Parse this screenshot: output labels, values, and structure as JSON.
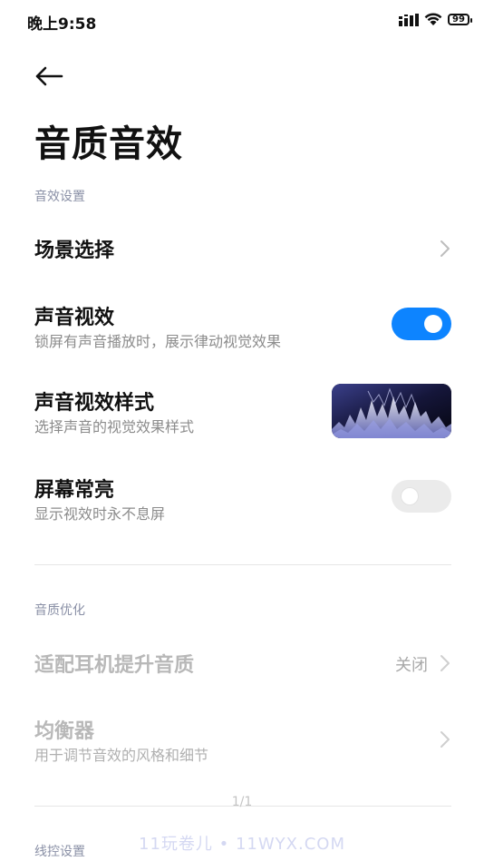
{
  "status_bar": {
    "time": "晚上9:58",
    "battery": "99",
    "icons": [
      "signal-icon",
      "wifi-icon",
      "battery-icon"
    ]
  },
  "header": {
    "back_icon": "back-arrow-icon",
    "title": "音质音效"
  },
  "sections": {
    "sound_effects": {
      "header": "音效设置",
      "scene": {
        "title": "场景选择"
      },
      "visual_effect": {
        "title": "声音视效",
        "subtitle": "锁屏有声音播放时，展示律动视觉效果",
        "enabled": true
      },
      "visual_style": {
        "title": "声音视效样式",
        "subtitle": "选择声音的视觉效果样式"
      },
      "screen_on": {
        "title": "屏幕常亮",
        "subtitle": "显示视效时永不息屏",
        "enabled": false
      }
    },
    "quality": {
      "header": "音质优化",
      "headphone": {
        "title": "适配耳机提升音质",
        "value": "关闭"
      },
      "equalizer": {
        "title": "均衡器",
        "subtitle": "用于调节音效的风格和细节"
      }
    },
    "wire_control": {
      "header": "线控设置"
    }
  },
  "overlay": {
    "page_indicator": "1/1",
    "watermark": "11玩卷儿 • 11WYX.COM"
  },
  "colors": {
    "accent": "#0d84ff",
    "section_header": "#8a90a6",
    "disabled_text": "#b8b8b8"
  }
}
